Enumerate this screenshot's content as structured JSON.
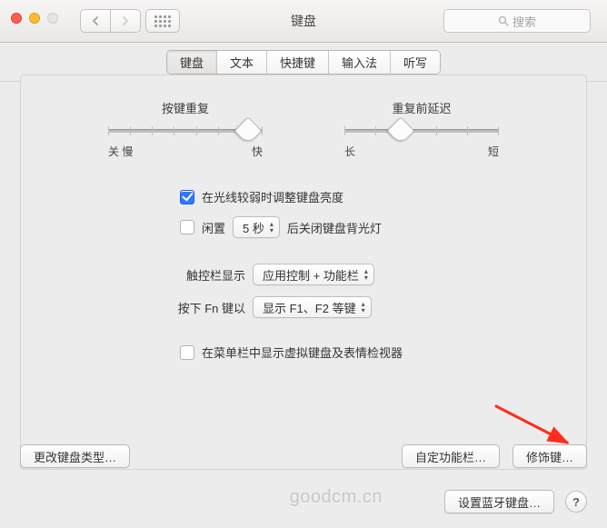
{
  "titlebar": {
    "title": "键盘",
    "search_placeholder": "搜索"
  },
  "tabs": {
    "items": [
      "键盘",
      "文本",
      "快捷键",
      "输入法",
      "听写"
    ],
    "selected_index": 0
  },
  "sliders": {
    "repeat": {
      "title": "按键重复",
      "min_label": "关 慢",
      "max_label": "快",
      "value_pct": 90
    },
    "delay": {
      "title": "重复前延迟",
      "min_label": "长",
      "max_label": "短",
      "value_pct": 36
    }
  },
  "options": {
    "dim_backlight": {
      "checked": true,
      "label": "在光线较弱时调整键盘亮度"
    },
    "idle": {
      "checked": false,
      "label_left": "闲置",
      "select_value": "5 秒",
      "label_right": "后关闭键盘背光灯"
    },
    "touchbar": {
      "label_left": "触控栏显示",
      "select_value": "应用控制 + 功能栏"
    },
    "fnkeys": {
      "label_left": "按下 Fn 键以",
      "select_value": "显示 F1、F2 等键"
    },
    "show_viewer": {
      "checked": false,
      "label": "在菜单栏中显示虚拟键盘及表情检视器"
    }
  },
  "buttons": {
    "change_type": "更改键盘类型…",
    "custom_touchbar": "自定功能栏…",
    "modifiers": "修饰键…",
    "bluetooth": "设置蓝牙键盘…",
    "help": "?"
  },
  "watermark": "goodcm.cn"
}
